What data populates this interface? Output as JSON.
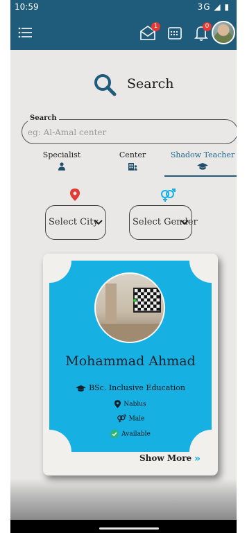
{
  "status_bar": {
    "time": "10:59",
    "network": "3G"
  },
  "app_bar": {
    "menu_icon": "menu-icon",
    "messages_badge": "1",
    "notifications_badge": "0"
  },
  "search": {
    "title": "Search",
    "field_label": "Search",
    "placeholder": "eg: Al-Amal center"
  },
  "tabs": [
    {
      "label": "Specialist",
      "icon": "specialist-icon"
    },
    {
      "label": "Center",
      "icon": "building-icon"
    },
    {
      "label": "Shadow Teacher",
      "icon": "graduation-cap-icon",
      "active": true
    }
  ],
  "filters": {
    "city_select": "Select City",
    "gender_select": "Select Gender"
  },
  "card": {
    "name": "Mohammad Ahmad",
    "degree": "BSc. Inclusive Education",
    "city": "Nablus",
    "gender": "Male",
    "status": "Available",
    "show_more": "Show More",
    "show_more_icon": "»"
  },
  "colors": {
    "primary": "#1f5b7a",
    "accent": "#17b0e3",
    "badge": "#e23a35",
    "pin": "#e23a35",
    "available": "#2bb673"
  }
}
